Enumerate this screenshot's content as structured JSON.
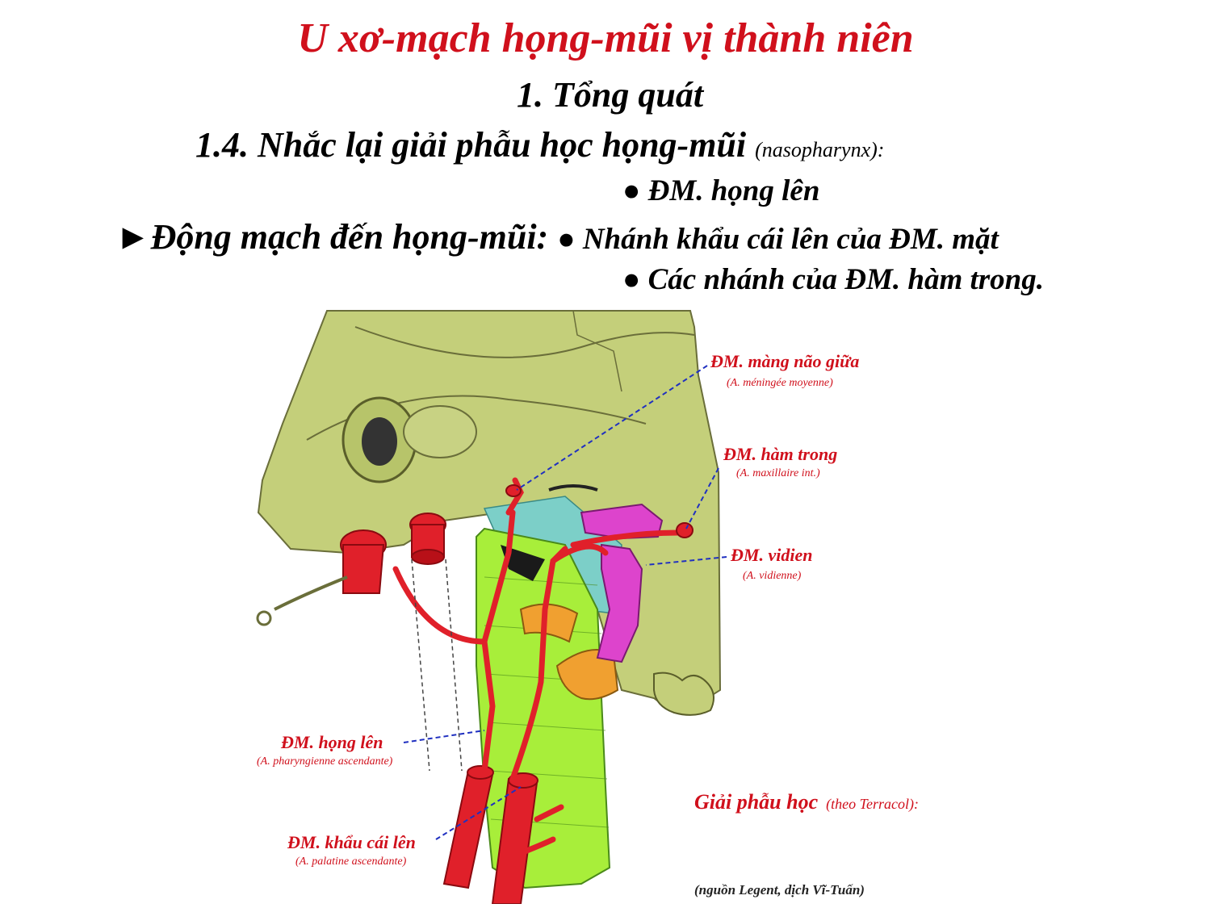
{
  "title": "U xơ-mạch họng-mũi vị thành niên",
  "section": "1. Tổng quát",
  "subsection": {
    "main": "1.4. Nhắc lại giải phẫu học họng-mũi",
    "note": "(nasopharynx):"
  },
  "arteries": {
    "arrow": "►",
    "lead": "Động mạch đến họng-mũi:",
    "bullet": "●",
    "items": [
      "ĐM. họng lên",
      "Nhánh khẩu cái lên của ĐM. mặt",
      "Các nhánh của ĐM. hàm trong."
    ]
  },
  "figure": {
    "labels": [
      {
        "name": "ĐM. màng não giữa",
        "latin": "(A. méningée moyenne)"
      },
      {
        "name": "ĐM. hàm trong",
        "latin": "(A. maxillaire int.)"
      },
      {
        "name": "ĐM. vidien",
        "latin": "(A. vidienne)"
      },
      {
        "name": "ĐM. họng lên",
        "latin": "(A. pharyngienne ascendante)"
      },
      {
        "name": "ĐM. khẩu cái lên",
        "latin": "(A. palatine ascendante)"
      }
    ],
    "caption_main": "Giải phẫu học",
    "caption_note": "(theo Terracol):",
    "source": "(nguồn Legent, dịch Vĩ-Tuấn)"
  },
  "colors": {
    "title": "#d0101c",
    "bone": "#c4cf7a",
    "artery": "#e0202a",
    "pharynx": "#a8ee3a",
    "mucosa": "#7ccfc8",
    "pterygoid": "#dd44cc",
    "tube": "#f0a030"
  }
}
